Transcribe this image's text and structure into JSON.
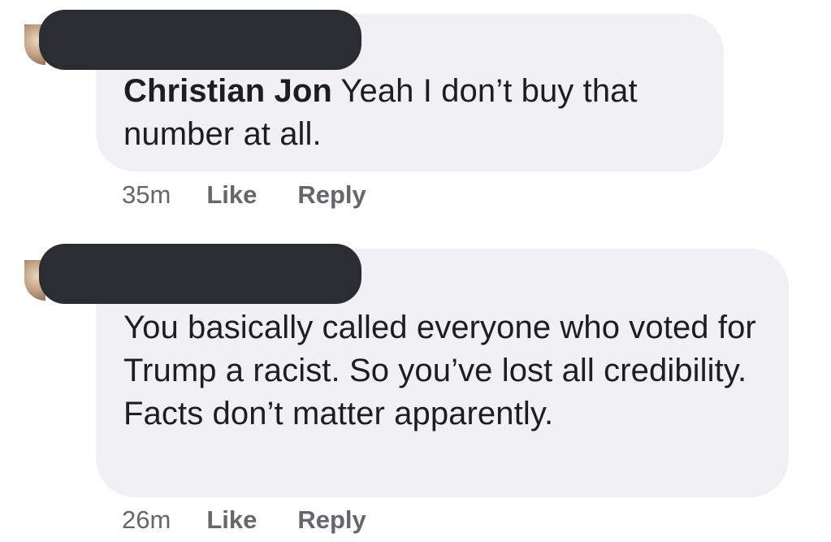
{
  "comments": [
    {
      "author": "Christian Jon",
      "text": " Yeah I don’t buy that number at all.",
      "time": "35m",
      "like_label": "Like",
      "reply_label": "Reply"
    },
    {
      "author": "",
      "text": "You basically called everyone who voted for Trump a racist. So you’ve lost all credibility. Facts don’t matter apparently.",
      "time": "26m",
      "like_label": "Like",
      "reply_label": "Reply"
    }
  ]
}
